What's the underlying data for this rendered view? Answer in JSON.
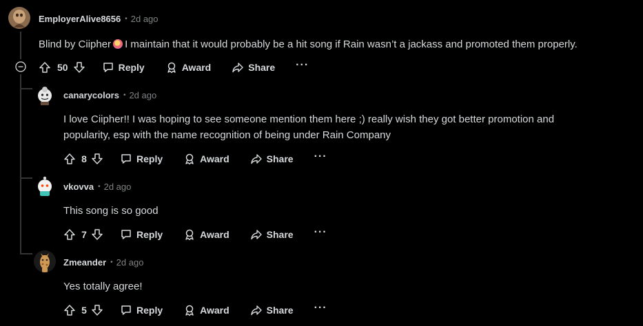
{
  "comments": [
    {
      "username": "EmployerAlive8656",
      "time": "2d ago",
      "text_before_emoji": "Blind by Ciipher",
      "text_after_emoji": "I maintain that it would probably be a hit song if Rain wasn’t a jackass and promoted them properly.",
      "votes": "50",
      "actions": {
        "reply": "Reply",
        "award": "Award",
        "share": "Share",
        "more": "···"
      }
    },
    {
      "username": "canarycolors",
      "time": "2d ago",
      "text_line1": "I love Ciipher!! I was hoping to see someone mention them here ;) really wish they got better promotion and",
      "text_line2": "popularity, esp with the name recognition of being under Rain Company",
      "votes": "8",
      "actions": {
        "reply": "Reply",
        "award": "Award",
        "share": "Share",
        "more": "···"
      }
    },
    {
      "username": "vkovva",
      "time": "2d ago",
      "text": "This song is so good",
      "votes": "7",
      "actions": {
        "reply": "Reply",
        "award": "Award",
        "share": "Share",
        "more": "···"
      }
    },
    {
      "username": "Zmeander",
      "time": "2d ago",
      "text": "Yes totally agree!",
      "votes": "5",
      "actions": {
        "reply": "Reply",
        "award": "Award",
        "share": "Share",
        "more": "···"
      }
    }
  ],
  "meta_separator": "•",
  "colors": {
    "background": "#000000",
    "text": "#d7dadc",
    "muted": "#818384",
    "thread_line": "#343536"
  }
}
